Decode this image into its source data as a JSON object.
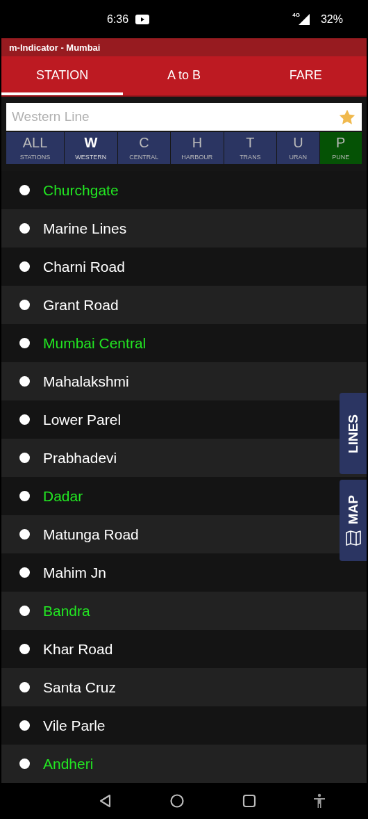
{
  "status_bar": {
    "time": "6:36",
    "network": "4G",
    "battery": "32%"
  },
  "app_title": "m-Indicator - Mumbai",
  "tabs": [
    {
      "label": "STATION",
      "selected": true
    },
    {
      "label": "A to B",
      "selected": false
    },
    {
      "label": "FARE",
      "selected": false
    }
  ],
  "search": {
    "placeholder": "Western Line"
  },
  "lines": [
    {
      "letter": "ALL",
      "label": "STATIONS",
      "selected": false,
      "color": "#2b3562"
    },
    {
      "letter": "W",
      "label": "WESTERN",
      "selected": true,
      "color": "#2b3562"
    },
    {
      "letter": "C",
      "label": "CENTRAL",
      "selected": false,
      "color": "#2b3562"
    },
    {
      "letter": "H",
      "label": "HARBOUR",
      "selected": false,
      "color": "#2b3562"
    },
    {
      "letter": "T",
      "label": "TRANS",
      "selected": false,
      "color": "#2b3562"
    },
    {
      "letter": "U",
      "label": "URAN",
      "selected": false,
      "color": "#2b3562"
    },
    {
      "letter": "P",
      "label": "PUNE",
      "selected": false,
      "color": "#055205"
    }
  ],
  "stations": [
    {
      "name": "Churchgate",
      "highlighted": true
    },
    {
      "name": "Marine Lines",
      "highlighted": false
    },
    {
      "name": "Charni Road",
      "highlighted": false
    },
    {
      "name": "Grant Road",
      "highlighted": false
    },
    {
      "name": "Mumbai Central",
      "highlighted": true
    },
    {
      "name": "Mahalakshmi",
      "highlighted": false
    },
    {
      "name": "Lower Parel",
      "highlighted": false
    },
    {
      "name": "Prabhadevi",
      "highlighted": false
    },
    {
      "name": "Dadar",
      "highlighted": true
    },
    {
      "name": "Matunga Road",
      "highlighted": false
    },
    {
      "name": "Mahim Jn",
      "highlighted": false
    },
    {
      "name": "Bandra",
      "highlighted": true
    },
    {
      "name": "Khar Road",
      "highlighted": false
    },
    {
      "name": "Santa Cruz",
      "highlighted": false
    },
    {
      "name": "Vile Parle",
      "highlighted": false
    },
    {
      "name": "Andheri",
      "highlighted": true
    }
  ],
  "side_tabs": [
    {
      "label": "LINES",
      "kind": "text"
    },
    {
      "label": "MAP",
      "kind": "map"
    }
  ]
}
